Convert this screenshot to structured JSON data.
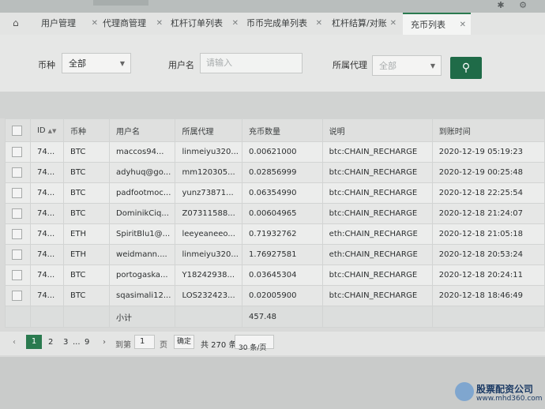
{
  "tabs": [
    {
      "label": "用户管理"
    },
    {
      "label": "代理商管理"
    },
    {
      "label": "杠杆订单列表"
    },
    {
      "label": "币币完成单列表"
    },
    {
      "label": "杠杆结算/对账"
    },
    {
      "label": "充币列表"
    }
  ],
  "filter": {
    "coin_label": "币种",
    "coin_value": "全部",
    "user_label": "用户名",
    "user_placeholder": "请输入",
    "agent_label": "所属代理",
    "agent_placeholder": "全部"
  },
  "table": {
    "headers": [
      "ID",
      "币种",
      "用户名",
      "所属代理",
      "充币数量",
      "说明",
      "到账时间"
    ],
    "rows": [
      [
        "74...",
        "BTC",
        "maccos94...",
        "linmeiyu320...",
        "0.00621000",
        "btc:CHAIN_RECHARGE",
        "2020-12-19 05:19:23"
      ],
      [
        "74...",
        "BTC",
        "adyhuq@go...",
        "mm120305...",
        "0.02856999",
        "btc:CHAIN_RECHARGE",
        "2020-12-19 00:25:48"
      ],
      [
        "74...",
        "BTC",
        "padfootmoc...",
        "yunz73871...",
        "0.06354990",
        "btc:CHAIN_RECHARGE",
        "2020-12-18 22:25:54"
      ],
      [
        "74...",
        "BTC",
        "DominikCiq...",
        "Z07311588...",
        "0.00604965",
        "btc:CHAIN_RECHARGE",
        "2020-12-18 21:24:07"
      ],
      [
        "74...",
        "ETH",
        "SpiritBlu1@...",
        "leeyeaneeo...",
        "0.71932762",
        "eth:CHAIN_RECHARGE",
        "2020-12-18 21:05:18"
      ],
      [
        "74...",
        "ETH",
        "weidmann....",
        "linmeiyu320...",
        "1.76927581",
        "eth:CHAIN_RECHARGE",
        "2020-12-18 20:53:24"
      ],
      [
        "74...",
        "BTC",
        "portogaska...",
        "Y18242938...",
        "0.03645304",
        "btc:CHAIN_RECHARGE",
        "2020-12-18 20:24:11"
      ],
      [
        "74...",
        "BTC",
        "sqasimali12...",
        "LOS232423...",
        "0.02005900",
        "btc:CHAIN_RECHARGE",
        "2020-12-18 18:46:49"
      ]
    ],
    "subtotal_label": "小计",
    "subtotal_value": "457.48"
  },
  "pager": {
    "pages": [
      "1",
      "2",
      "3",
      "...",
      "9"
    ],
    "goto_label": "到第",
    "goto_value": "1",
    "page_unit": "页",
    "confirm": "确定",
    "total": "共 270 条",
    "per_page": "30 条/页"
  },
  "watermark": {
    "name": "股票配资公司",
    "url": "www.mhd360.com"
  }
}
